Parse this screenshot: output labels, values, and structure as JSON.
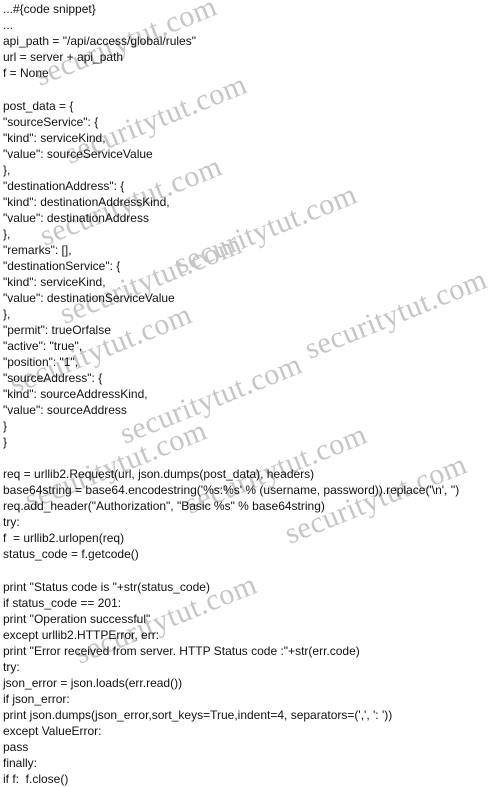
{
  "watermark": {
    "text": "securitytut.com",
    "color": "#c6c6c6"
  },
  "code_lines": [
    "...#{code snippet}",
    "...",
    "api_path = \"/api/access/global/rules\"",
    "url = server + api_path",
    "f = None",
    "",
    "post_data = {",
    "\"sourceService\": {",
    "\"kind\": serviceKind,",
    "\"value\": sourceServiceValue",
    "},",
    "\"destinationAddress\": {",
    "\"kind\": destinationAddressKind,",
    "\"value\": destinationAddress",
    "},",
    "\"remarks\": [],",
    "\"destinationService\": {",
    "\"kind\": serviceKind,",
    "\"value\": destinationServiceValue",
    "},",
    "\"permit\": trueOrfalse",
    "\"active\": \"true\",",
    "\"position\": \"1\",",
    "\"sourceAddress\": {",
    "\"kind\": sourceAddressKind,",
    "\"value\": sourceAddress",
    "}",
    "}",
    "",
    "req = urllib2.Request(url, json.dumps(post_data), headers)",
    "base64string = base64.encodestring('%s:%s' % (username, password)).replace('\\n', '')",
    "req.add_header(\"Authorization\", \"Basic %s\" % base64string)",
    "try:",
    "f  = urllib2.urlopen(req)",
    "status_code = f.getcode()",
    "",
    "print \"Status code is \"+str(status_code)",
    "if status_code == 201:",
    "print \"Operation successful\"",
    "except urllib2.HTTPError, err:",
    "print \"Error received from server. HTTP Status code :\"+str(err.code)",
    "try:",
    "json_error = json.loads(err.read())",
    "if json_error:",
    "print json.dumps(json_error,sort_keys=True,indent=4, separators=(',', ': '))",
    "except ValueError:",
    "pass",
    "finally:",
    "if f:  f.close()"
  ]
}
